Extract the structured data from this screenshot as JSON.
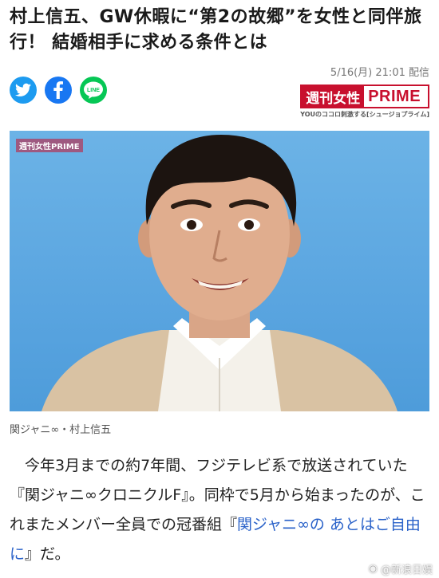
{
  "article": {
    "headline": "村上信五、GW休暇に“第2の故郷”を女性と同伴旅行！ 結婚相手に求める条件とは",
    "date": "5/16(月) 21:01 配信"
  },
  "share": {
    "twitter_icon": "twitter-bird-icon",
    "facebook_icon": "facebook-f-icon",
    "line_label": "LINE",
    "colors": {
      "twitter": "#1d9bf0",
      "facebook": "#1877f2",
      "line": "#06c755"
    }
  },
  "brand": {
    "name_jp": "週刊女性",
    "name_en": "PRIME",
    "tagline": "YOUのココロ刺激する[シュージョプライム]",
    "color": "#c8102e"
  },
  "photo": {
    "watermark": "週刊女性PRIME",
    "caption": "関ジャニ∞・村上信五"
  },
  "body": {
    "p1_before": "今年3月までの約7年間、フジテレビ系で放送されていた『関ジャニ∞クロニクルF』。同枠で5月から始まったのが、これまたメンバー全員での冠番組『",
    "p1_link": "関ジャニ∞の あとはご自由に",
    "p1_after": "』だ。"
  },
  "overlay": {
    "watermark": "@新浪日娱"
  }
}
